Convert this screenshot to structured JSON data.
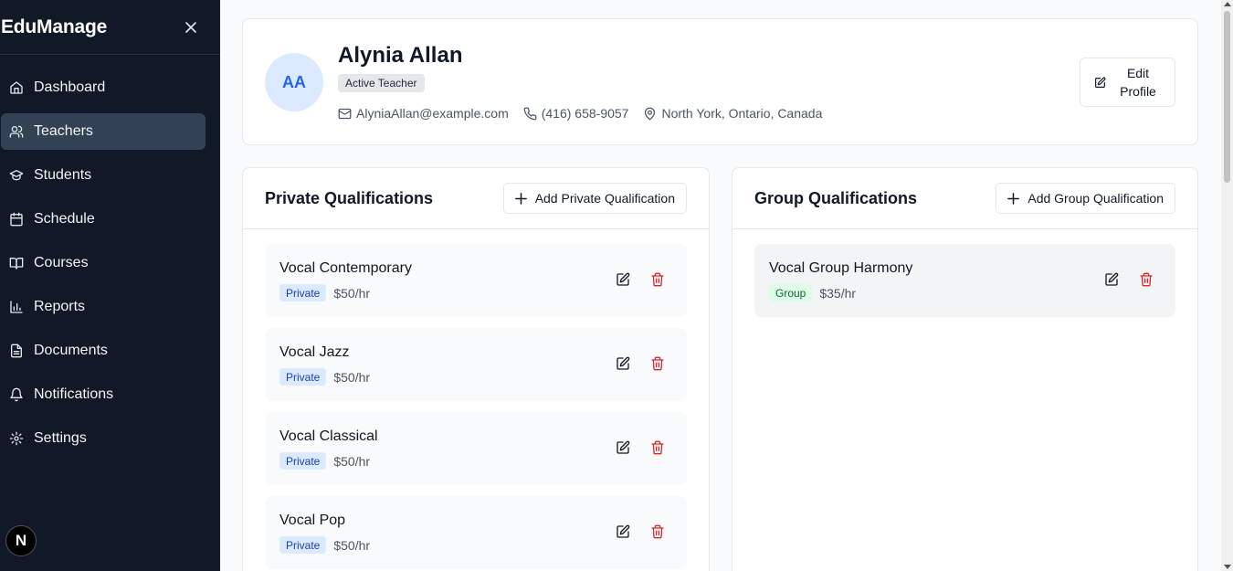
{
  "app": {
    "title": "EduManage"
  },
  "sidebar": {
    "items": [
      {
        "label": "Dashboard",
        "icon": "home-icon",
        "active": false
      },
      {
        "label": "Teachers",
        "icon": "users-icon",
        "active": true
      },
      {
        "label": "Students",
        "icon": "graduation-cap-icon",
        "active": false
      },
      {
        "label": "Schedule",
        "icon": "calendar-icon",
        "active": false
      },
      {
        "label": "Courses",
        "icon": "book-open-icon",
        "active": false
      },
      {
        "label": "Reports",
        "icon": "bar-chart-icon",
        "active": false
      },
      {
        "label": "Documents",
        "icon": "file-text-icon",
        "active": false
      },
      {
        "label": "Notifications",
        "icon": "bell-icon",
        "active": false
      },
      {
        "label": "Settings",
        "icon": "gear-icon",
        "active": false
      }
    ],
    "footer_badge": "N"
  },
  "profile": {
    "initials": "AA",
    "name": "Alynia Allan",
    "status": "Active Teacher",
    "email": "AlyniaAllan@example.com",
    "phone": "(416) 658-9057",
    "location": "North York, Ontario, Canada",
    "edit_label": "Edit Profile"
  },
  "private_qualifications": {
    "title": "Private Qualifications",
    "add_label": "Add Private Qualification",
    "items": [
      {
        "name": "Vocal Contemporary",
        "type": "Private",
        "rate": "$50/hr"
      },
      {
        "name": "Vocal Jazz",
        "type": "Private",
        "rate": "$50/hr"
      },
      {
        "name": "Vocal Classical",
        "type": "Private",
        "rate": "$50/hr"
      },
      {
        "name": "Vocal Pop",
        "type": "Private",
        "rate": "$50/hr"
      }
    ]
  },
  "group_qualifications": {
    "title": "Group Qualifications",
    "add_label": "Add Group Qualification",
    "items": [
      {
        "name": "Vocal Group Harmony",
        "type": "Group",
        "rate": "$35/hr"
      }
    ]
  },
  "colors": {
    "sidebar_bg": "#111827",
    "active_nav_bg": "#334155",
    "accent_blue": "#2563eb",
    "delete_red": "#dc2626"
  }
}
